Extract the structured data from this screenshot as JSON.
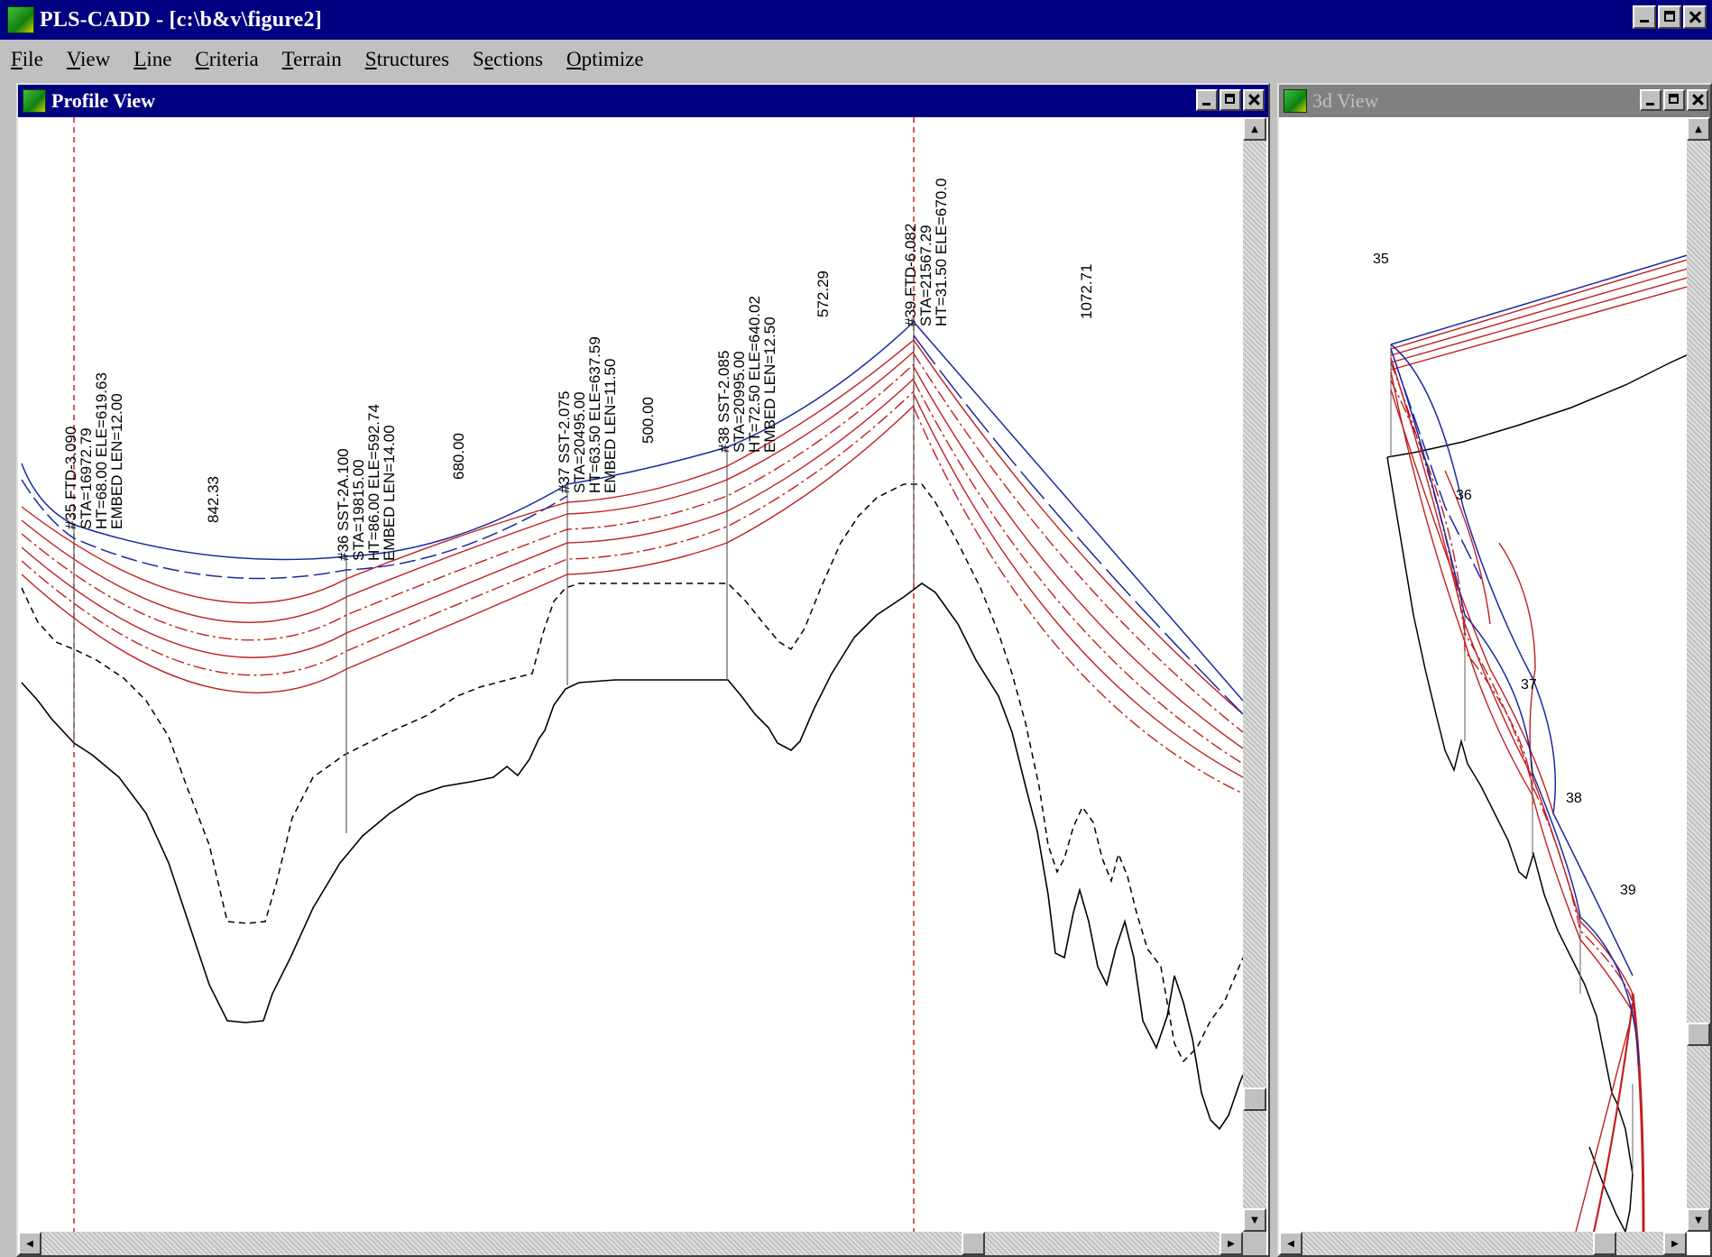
{
  "app": {
    "title": "PLS-CADD - [c:\\b&v\\figure2]"
  },
  "menu": {
    "items": [
      {
        "label": "File",
        "key": "F"
      },
      {
        "label": "View",
        "key": "V"
      },
      {
        "label": "Line",
        "key": "L"
      },
      {
        "label": "Criteria",
        "key": "C"
      },
      {
        "label": "Terrain",
        "key": "T"
      },
      {
        "label": "Structures",
        "key": "S"
      },
      {
        "label": "Sections",
        "key": "e"
      },
      {
        "label": "Optimize",
        "key": "O"
      }
    ]
  },
  "profile_view": {
    "title": "Profile View",
    "structures": [
      {
        "lines": [
          "#35 FTD-3.090",
          "STA=16972.79",
          "HT=68.00 ELE=619.63",
          "EMBED LEN=12.00"
        ]
      },
      {
        "lines": [
          "#36 SST-2A.100",
          "STA=19815.00",
          "HT=86.00 ELE=592.74",
          "EMBED LEN=14.00"
        ]
      },
      {
        "lines": [
          "#37 SST-2.075",
          "STA=20495.00",
          "HT=63.50 ELE=637.59",
          "EMBED LEN=11.50"
        ]
      },
      {
        "lines": [
          "#38 SST-2.085",
          "STA=20995.00",
          "HT=72.50 ELE=640.02",
          "EMBED LEN=12.50"
        ]
      },
      {
        "lines": [
          "#39 FTD-6.082",
          "STA=21567.29",
          "HT=31.50 ELE=670.0"
        ]
      }
    ],
    "span_lengths": [
      "842.33",
      "680.00",
      "500.00",
      "572.29",
      "1072.71"
    ]
  },
  "view_3d": {
    "title": "3d View",
    "structure_labels": [
      "35",
      "36",
      "37",
      "38",
      "39"
    ]
  },
  "colors": {
    "title_active": "#000080",
    "title_inactive": "#808080",
    "conductor_red": "#c02020",
    "conductor_blue": "#1a2aa0",
    "ground": "#000000",
    "marker_red": "#d02020"
  },
  "icons": {
    "app": "pls-cadd-app-icon",
    "child": "pls-cadd-window-icon"
  }
}
